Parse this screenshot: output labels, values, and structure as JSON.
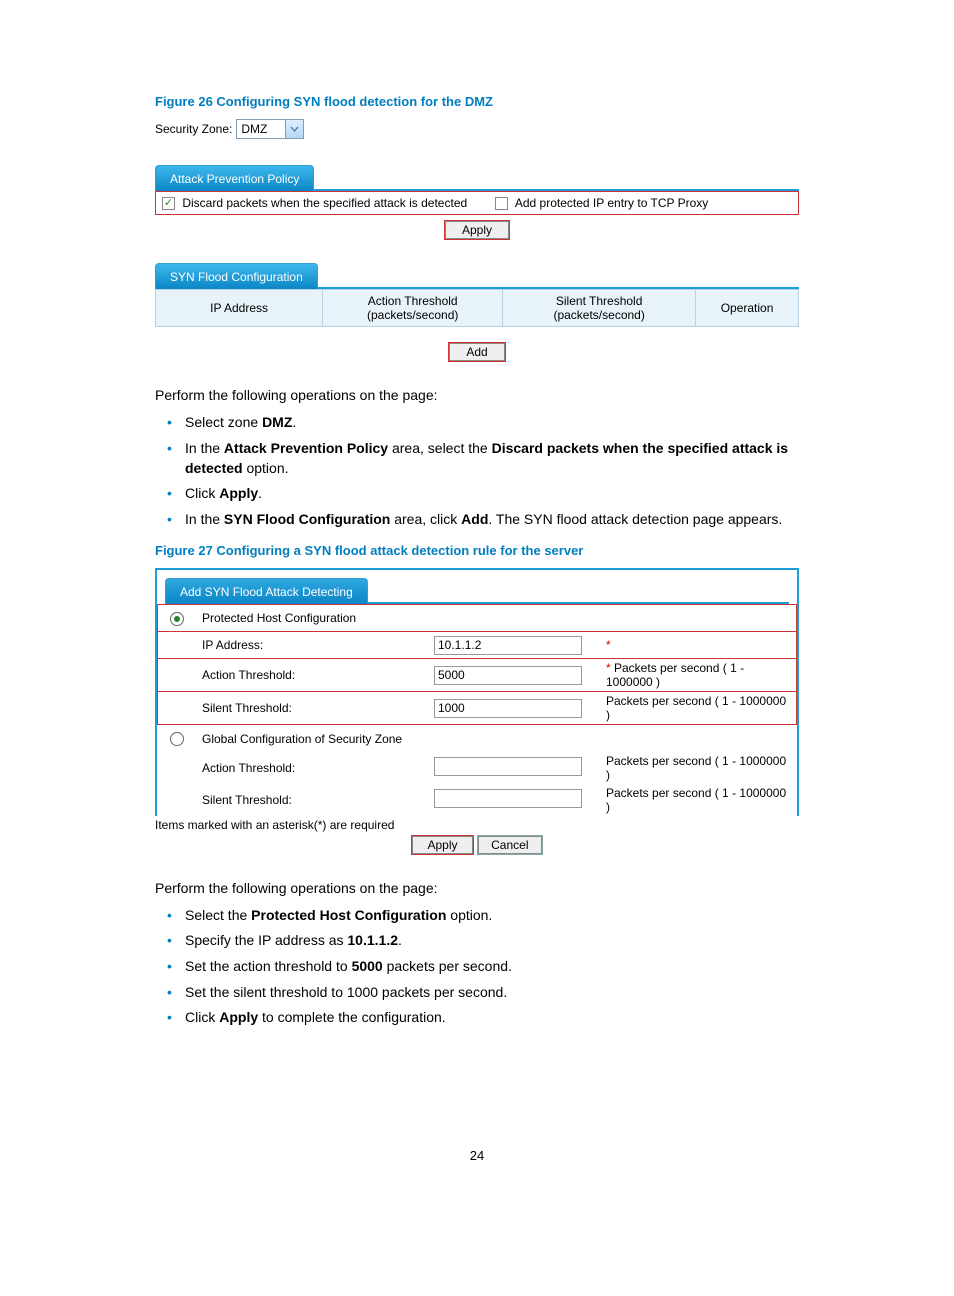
{
  "fig26": {
    "caption": "Figure 26 Configuring SYN flood detection for the DMZ",
    "zoneLabel": "Security Zone:",
    "zoneValue": "DMZ",
    "policyTab": "Attack Prevention Policy",
    "chkDiscardLabel": "Discard packets when the specified attack is detected",
    "chkProxyLabel": "Add protected IP entry to TCP Proxy",
    "applyLabel": "Apply",
    "synTab": "SYN Flood Configuration",
    "th": {
      "ip": "IP Address",
      "action": "Action Threshold (packets/second)",
      "silent": "Silent Threshold (packets/second)",
      "op": "Operation"
    },
    "addLabel": "Add"
  },
  "intro1": "Perform the following operations on the page:",
  "bullets1": {
    "a_pre": "Select zone ",
    "a_b": "DMZ",
    "a_post": ".",
    "b_pre": "In the ",
    "b_b1": "Attack Prevention Policy",
    "b_mid": " area, select the ",
    "b_b2": "Discard packets when the specified attack is detected",
    "b_post": " option.",
    "c_pre": "Click ",
    "c_b": "Apply",
    "c_post": ".",
    "d_pre": "In the ",
    "d_b1": "SYN Flood Configuration",
    "d_mid": " area, click ",
    "d_b2": "Add",
    "d_post": ". The SYN flood attack detection page appears."
  },
  "fig27": {
    "caption": "Figure 27 Configuring a SYN flood attack detection rule for the server",
    "tab": "Add SYN Flood Attack Detecting",
    "radio1Label": "Protected Host Configuration",
    "ipLabel": "IP Address:",
    "ipValue": "10.1.1.2",
    "actionLabel": "Action Threshold:",
    "actionValue": "5000",
    "silentLabel": "Silent Threshold:",
    "silentValue": "1000",
    "radio2Label": "Global Configuration of Security Zone",
    "g_actionLabel": "Action Threshold:",
    "g_silentLabel": "Silent Threshold:",
    "hintStar": "*",
    "hintPkts": "Packets per second ( 1 - 1000000 )",
    "hintPktsStar": " Packets per second ( 1 - 1000000 )",
    "reqNote": "Items marked with an asterisk(*) are required",
    "applyLabel": "Apply",
    "cancelLabel": "Cancel"
  },
  "intro2": "Perform the following operations on the page:",
  "bullets2": {
    "a_pre": "Select the ",
    "a_b": "Protected Host Configuration",
    "a_post": " option.",
    "b_pre": "Specify the IP address as ",
    "b_b": "10.1.1.2",
    "b_post": ".",
    "c_pre": "Set the action threshold to ",
    "c_b": "5000",
    "c_post": " packets per second.",
    "d": "Set the silent threshold to 1000 packets per second.",
    "e_pre": "Click ",
    "e_b": "Apply",
    "e_post": " to complete the configuration."
  },
  "pageNumber": "24"
}
